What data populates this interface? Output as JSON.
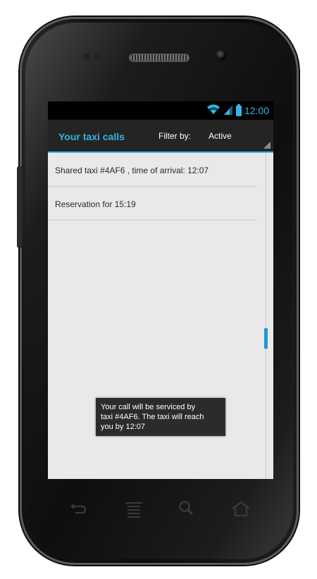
{
  "status_bar": {
    "time": "12:00"
  },
  "action_bar": {
    "title": "Your taxi calls",
    "filter_label": "Filter by:",
    "filter_value": "Active"
  },
  "list": {
    "items": [
      {
        "label": "Shared taxi #4AF6 , time of arrival: 12:07"
      },
      {
        "label": "Reservation for 15:19"
      }
    ]
  },
  "toast": {
    "lines": [
      "Your call will be serviced by",
      "taxi #4AF6. The taxi will reach",
      "you by 12:07"
    ]
  },
  "icons": {
    "wifi": "wifi-icon",
    "signal": "signal-icon",
    "battery": "battery-icon",
    "back": "back-icon",
    "menu": "menu-icon",
    "search": "search-icon",
    "home": "home-icon"
  },
  "colors": {
    "accent": "#33b5e5",
    "action_bar": "#242424",
    "screen_background": "#e9e9e9",
    "toast": "#2b2b2b"
  }
}
